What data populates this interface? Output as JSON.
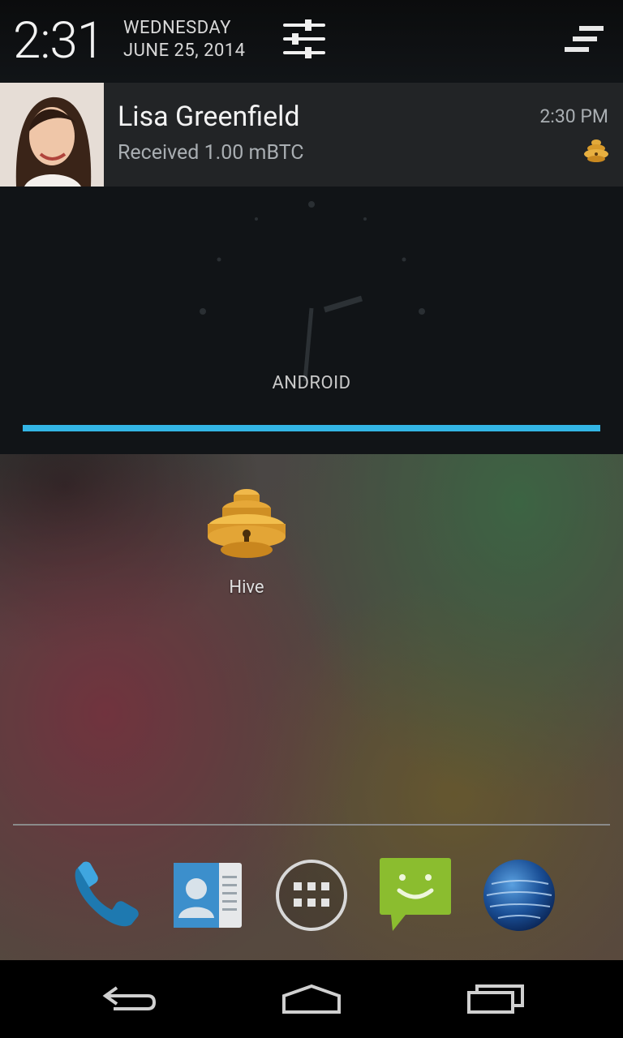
{
  "status": {
    "time": "2:31",
    "day": "WEDNESDAY",
    "date": "JUNE 25, 2014"
  },
  "notification": {
    "title": "Lisa Greenfield",
    "text": "Received 1.00 mBTC",
    "time": "2:30 PM",
    "avatar_icon": "contact-photo",
    "small_icon": "hive-icon"
  },
  "lockscreen": {
    "carrier": "ANDROID",
    "progress_fraction": 1.0
  },
  "home": {
    "apps": [
      {
        "label": "Hive",
        "icon": "hive-icon"
      }
    ],
    "dock": [
      {
        "icon": "phone-icon"
      },
      {
        "icon": "contacts-icon"
      },
      {
        "icon": "app-drawer-icon"
      },
      {
        "icon": "messaging-icon"
      },
      {
        "icon": "browser-icon"
      }
    ]
  },
  "navigation": {
    "buttons": [
      "back-icon",
      "home-icon",
      "recents-icon"
    ]
  },
  "colors": {
    "accent": "#33b5e5",
    "shade_bg": "#111417",
    "card_bg": "#222426"
  }
}
